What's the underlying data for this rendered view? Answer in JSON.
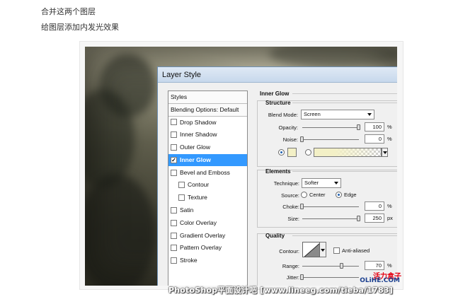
{
  "captions": [
    "合并这两个图层",
    "给图层添加内发光效果"
  ],
  "dialog": {
    "title": "Layer Style",
    "styles_list": [
      {
        "label": "Styles",
        "type": "head"
      },
      {
        "label": "Blending Options: Default",
        "type": "head"
      },
      {
        "label": "Drop Shadow",
        "checked": false
      },
      {
        "label": "Inner Shadow",
        "checked": false
      },
      {
        "label": "Outer Glow",
        "checked": false
      },
      {
        "label": "Inner Glow",
        "checked": true,
        "selected": true
      },
      {
        "label": "Bevel and Emboss",
        "checked": false
      },
      {
        "label": "Contour",
        "checked": false,
        "indent": true
      },
      {
        "label": "Texture",
        "checked": false,
        "indent": true
      },
      {
        "label": "Satin",
        "checked": false
      },
      {
        "label": "Color Overlay",
        "checked": false
      },
      {
        "label": "Gradient Overlay",
        "checked": false
      },
      {
        "label": "Pattern Overlay",
        "checked": false
      },
      {
        "label": "Stroke",
        "checked": false
      }
    ],
    "panel_title": "Inner Glow",
    "structure": {
      "title": "Structure",
      "blend_mode_label": "Blend Mode:",
      "blend_mode_value": "Screen",
      "opacity_label": "Opacity:",
      "opacity_value": "100",
      "opacity_unit": "%",
      "opacity_fraction": 1.0,
      "noise_label": "Noise:",
      "noise_value": "0",
      "noise_unit": "%",
      "noise_fraction": 0.0,
      "glow_color": "#f3f0c6",
      "color_mode_selected": "solid"
    },
    "elements": {
      "title": "Elements",
      "technique_label": "Technique:",
      "technique_value": "Softer",
      "source_label": "Source:",
      "source_center": "Center",
      "source_edge": "Edge",
      "source_selected": "Edge",
      "choke_label": "Choke:",
      "choke_value": "0",
      "choke_unit": "%",
      "choke_fraction": 0.0,
      "size_label": "Size:",
      "size_value": "250",
      "size_unit": "px",
      "size_fraction": 1.0
    },
    "quality": {
      "title": "Quality",
      "contour_label": "Contour:",
      "anti_aliased_label": "Anti-aliased",
      "anti_aliased": false,
      "range_label": "Range:",
      "range_value": "70",
      "range_unit": "%",
      "range_fraction": 0.7,
      "jitter_label": "Jitter:",
      "jitter_fraction": 0.0
    }
  },
  "watermarks": {
    "logo_line1": "活力盒子",
    "logo_line2": "OLiHE.COM",
    "bottom": "PhotoShop平面设计吧 [www.lineeg.com/tieba/1783]"
  }
}
